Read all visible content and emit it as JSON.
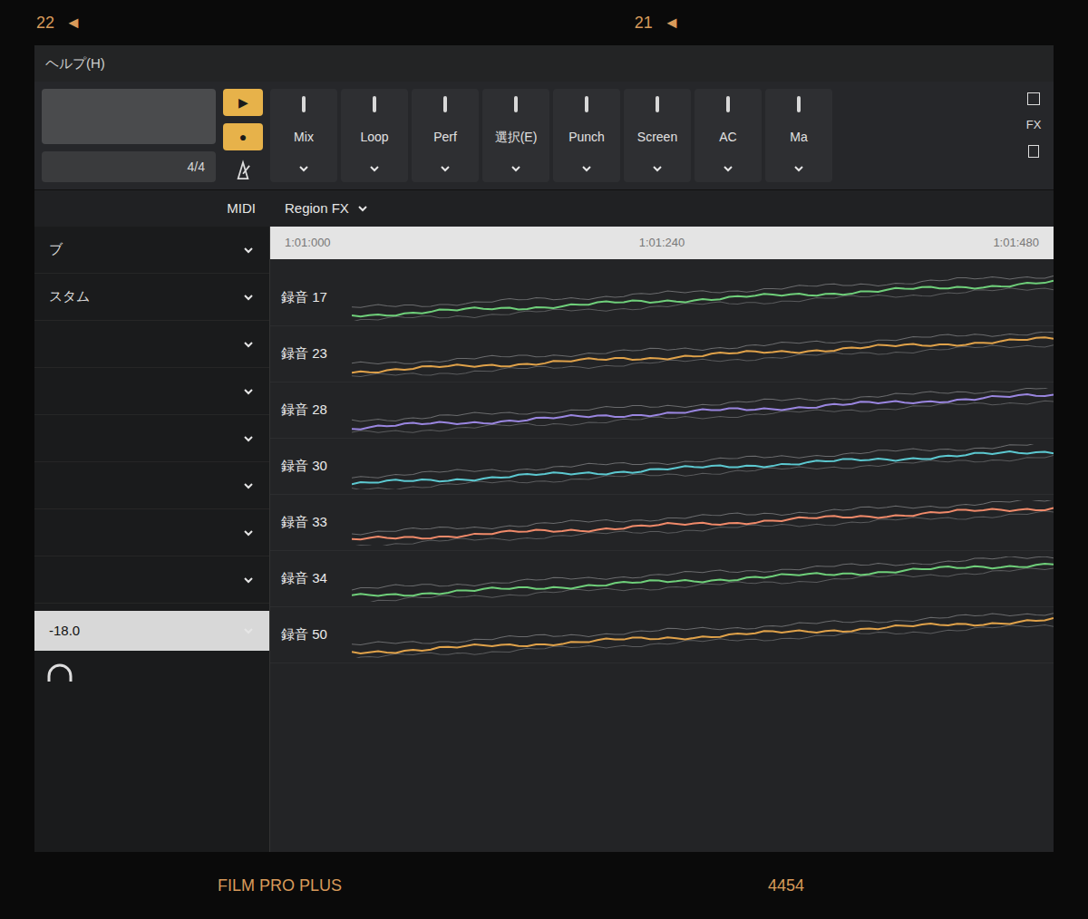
{
  "film": {
    "top_left": "22",
    "top_right": "21",
    "arrow": "◄",
    "brand": "FILM PRO PLUS",
    "frame": "4454"
  },
  "menu": {
    "item": "ヘルプ(H)"
  },
  "transport": {
    "play": "▶",
    "record": "●",
    "meter": "4/4"
  },
  "toolbar": [
    {
      "label": "Mix"
    },
    {
      "label": "Loop"
    },
    {
      "label": "Perf"
    },
    {
      "label": "選択(E)"
    },
    {
      "label": "Punch"
    },
    {
      "label": "Screen"
    },
    {
      "label": "AC"
    },
    {
      "label": "Ma"
    }
  ],
  "subbar": {
    "midi": "MIDI",
    "region_fx": "Region FX"
  },
  "side_panel": {
    "label": "FX"
  },
  "timeline": {
    "ticks": [
      "1:01:000",
      "1:01:240",
      "1:01:480"
    ]
  },
  "inspector": {
    "rows": [
      {
        "label": "ブ"
      },
      {
        "label": "スタム"
      },
      {
        "label": ""
      },
      {
        "label": ""
      },
      {
        "label": ""
      },
      {
        "label": ""
      },
      {
        "label": ""
      },
      {
        "label": ""
      }
    ],
    "volume": "-18.0"
  },
  "tracks": [
    {
      "name": "録音 17",
      "color": "#6fcf7a"
    },
    {
      "name": "録音 23",
      "color": "#e0a24a"
    },
    {
      "name": "録音 28",
      "color": "#9a86e0"
    },
    {
      "name": "録音 30",
      "color": "#5cc8d0"
    },
    {
      "name": "録音 33",
      "color": "#f08a6a"
    },
    {
      "name": "録音 34",
      "color": "#6fcf7a"
    },
    {
      "name": "録音 50",
      "color": "#e0a24a"
    }
  ]
}
